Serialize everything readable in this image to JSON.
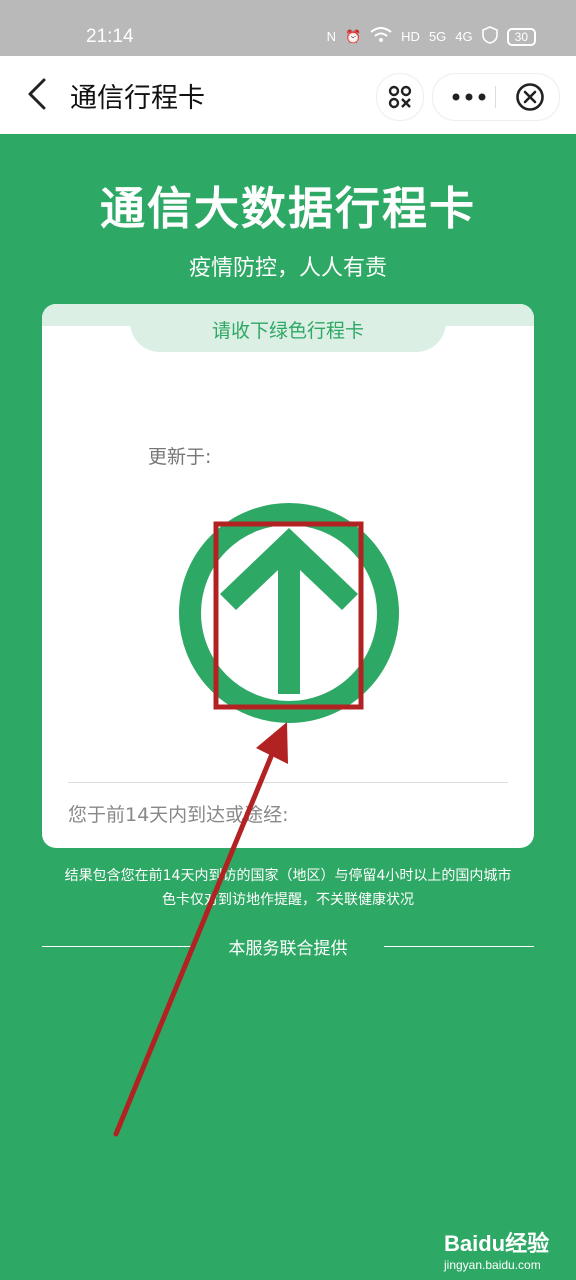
{
  "status_bar": {
    "time": "21:14",
    "network_5g": "5G",
    "network_4g": "4G",
    "battery": "30"
  },
  "nav": {
    "title": "通信行程卡"
  },
  "hero": {
    "title": "通信大数据行程卡",
    "subtitle": "疫情防控，人人有责"
  },
  "card": {
    "tab_label": "请收下绿色行程卡",
    "updated_label": "更新于:",
    "route_label": "您于前14天内到达或途经:",
    "sign_color": "#2ea865",
    "sign_icon": "up-arrow-circle-icon"
  },
  "note": {
    "line1": "结果包含您在前14天内到访的国家（地区）与停留4小时以上的国内城市",
    "line2": "色卡仅对到访地作提醒，不关联健康状况"
  },
  "footer": {
    "label": "本服务联合提供"
  },
  "annotation": {
    "highlight_color": "#b22222"
  },
  "watermark": {
    "brand": "Baidu经验",
    "url": "jingyan.baidu.com"
  }
}
